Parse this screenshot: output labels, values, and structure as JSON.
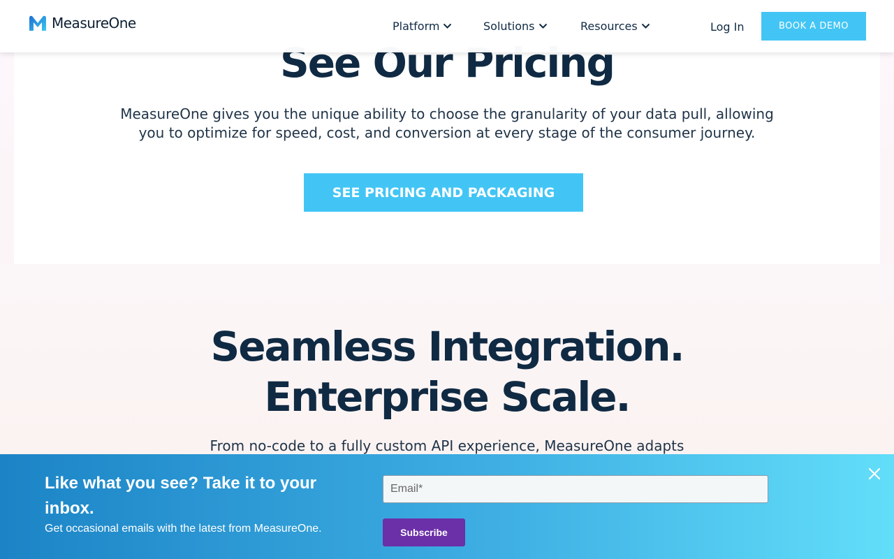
{
  "header": {
    "logo_text": "MeasureOne",
    "nav": [
      {
        "label": "Platform"
      },
      {
        "label": "Solutions"
      },
      {
        "label": "Resources"
      }
    ],
    "login_label": "Log In",
    "demo_label": "BOOK A DEMO"
  },
  "pricing": {
    "title": "See Our Pricing",
    "description": "MeasureOne gives you the unique ability to choose the granularity of your data pull, allowing you to optimize for speed, cost, and conversion at every stage of the consumer journey.",
    "button_label": "SEE PRICING AND PACKAGING"
  },
  "integration": {
    "title_line1": "Seamless Integration.",
    "title_line2": "Enterprise Scale.",
    "description": "From no-code to a fully custom API experience, MeasureOne adapts"
  },
  "newsletter": {
    "heading": "Like what you see? Take it to your inbox.",
    "subtext": "Get occasional emails with the latest from MeasureOne.",
    "email_placeholder": "Email*",
    "subscribe_label": "Subscribe"
  },
  "colors": {
    "accent": "#42c5f5",
    "heading": "#102a43",
    "subscribe": "#6b2fa8"
  },
  "icons": {
    "logo": "measureone-logo-icon",
    "nav_dropdown": "chevron-down-icon",
    "close": "close-icon"
  }
}
